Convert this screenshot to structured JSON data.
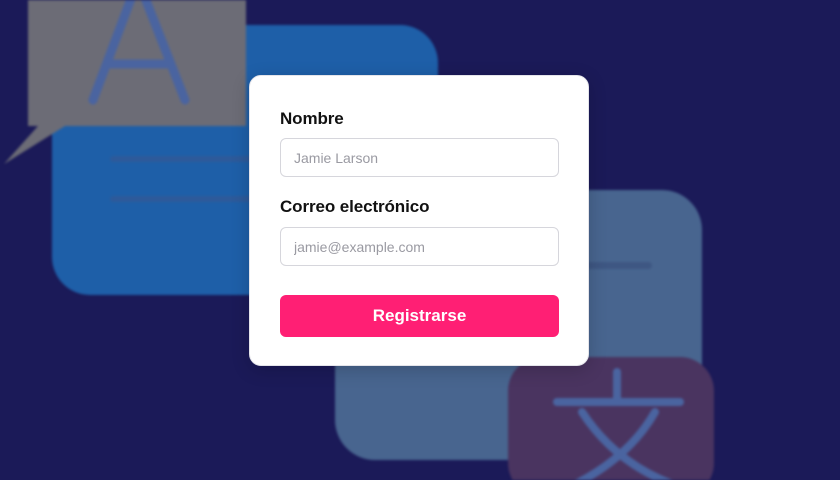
{
  "form": {
    "name_label": "Nombre",
    "name_placeholder": "Jamie Larson",
    "email_label": "Correo electrónico",
    "email_placeholder": "jamie@example.com",
    "submit_label": "Registrarse"
  },
  "background": {
    "latin_glyph": "A",
    "cjk_glyph": "文",
    "colors": {
      "page": "#1b1a58",
      "blue_bubble": "#1e5fa8",
      "gray_bubble": "#6c6c76",
      "light_blue_bubble": "#48658f",
      "purple_bubble": "#4a3460"
    }
  },
  "theme": {
    "accent": "#ff1f74",
    "card": "#ffffff"
  }
}
